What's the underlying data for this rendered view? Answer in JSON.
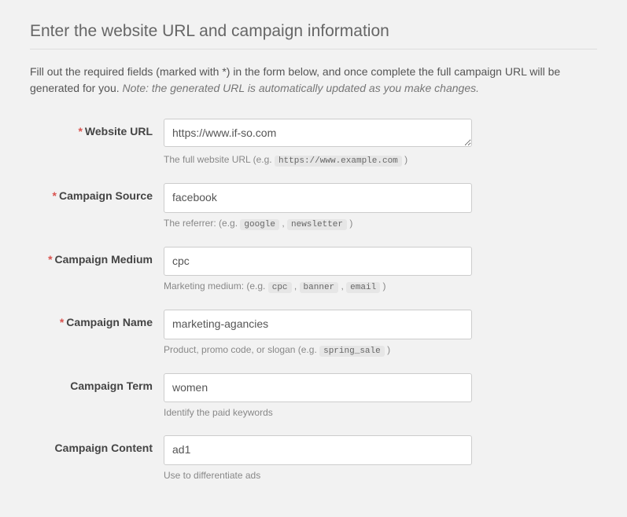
{
  "heading": "Enter the website URL and campaign information",
  "intro_text": "Fill out the required fields (marked with *) in the form below, and once complete the full campaign URL will be generated for you. ",
  "intro_note": "Note: the generated URL is automatically updated as you make changes.",
  "fields": {
    "website_url": {
      "label": "Website URL",
      "required": "*",
      "value": "https://www.if-so.com",
      "help_pre": "The full website URL (e.g. ",
      "help_code1": "https://www.example.com",
      "help_post": " )"
    },
    "campaign_source": {
      "label": "Campaign Source",
      "required": "*",
      "value": "facebook",
      "help_pre": "The referrer: (e.g. ",
      "help_code1": "google",
      "help_sep1": " , ",
      "help_code2": "newsletter",
      "help_post": " )"
    },
    "campaign_medium": {
      "label": "Campaign Medium",
      "required": "*",
      "value": "cpc",
      "help_pre": "Marketing medium: (e.g. ",
      "help_code1": "cpc",
      "help_sep1": " , ",
      "help_code2": "banner",
      "help_sep2": " , ",
      "help_code3": "email",
      "help_post": " )"
    },
    "campaign_name": {
      "label": "Campaign Name",
      "required": "*",
      "value": "marketing-agancies",
      "help_pre": "Product, promo code, or slogan (e.g. ",
      "help_code1": "spring_sale",
      "help_post": " )"
    },
    "campaign_term": {
      "label": "Campaign Term",
      "value": "women",
      "help_pre": "Identify the paid keywords"
    },
    "campaign_content": {
      "label": "Campaign Content",
      "value": "ad1",
      "help_pre": "Use to differentiate ads"
    }
  }
}
